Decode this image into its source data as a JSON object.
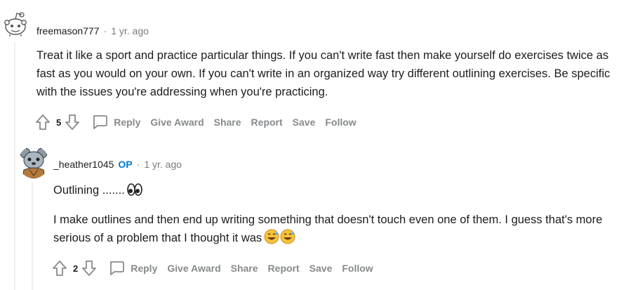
{
  "comments": [
    {
      "username": "freemason777",
      "is_op": false,
      "separator": "·",
      "time": "1 yr. ago",
      "paragraphs": [
        "Treat it like a sport and practice particular things. If you can't write fast then make yourself do exercises twice as fast as you would on your own. If you can't write in an organized way try different outlining exercises. Be specific with the issues you're addressing when you're practicing."
      ],
      "score": "5",
      "actions": {
        "reply": "Reply",
        "give_award": "Give Award",
        "share": "Share",
        "report": "Report",
        "save": "Save",
        "follow": "Follow"
      }
    },
    {
      "username": "_heather1045",
      "is_op": true,
      "op_label": "OP",
      "separator": "·",
      "time": "1 yr. ago",
      "paragraphs": [
        "Outlining .......",
        "I make outlines and then end up writing something that doesn't touch even one of them. I guess that's more serious of a problem that I thought it was"
      ],
      "emojis": [
        "eyes-emoji",
        "sweat-smile-emoji"
      ],
      "score": "2",
      "actions": {
        "reply": "Reply",
        "give_award": "Give Award",
        "share": "Share",
        "report": "Report",
        "save": "Save",
        "follow": "Follow"
      }
    }
  ],
  "colors": {
    "meta_gray": "#787c7e",
    "action_gray": "#878a8c",
    "op_blue": "#0079d3",
    "thread_line": "#edeff1"
  }
}
